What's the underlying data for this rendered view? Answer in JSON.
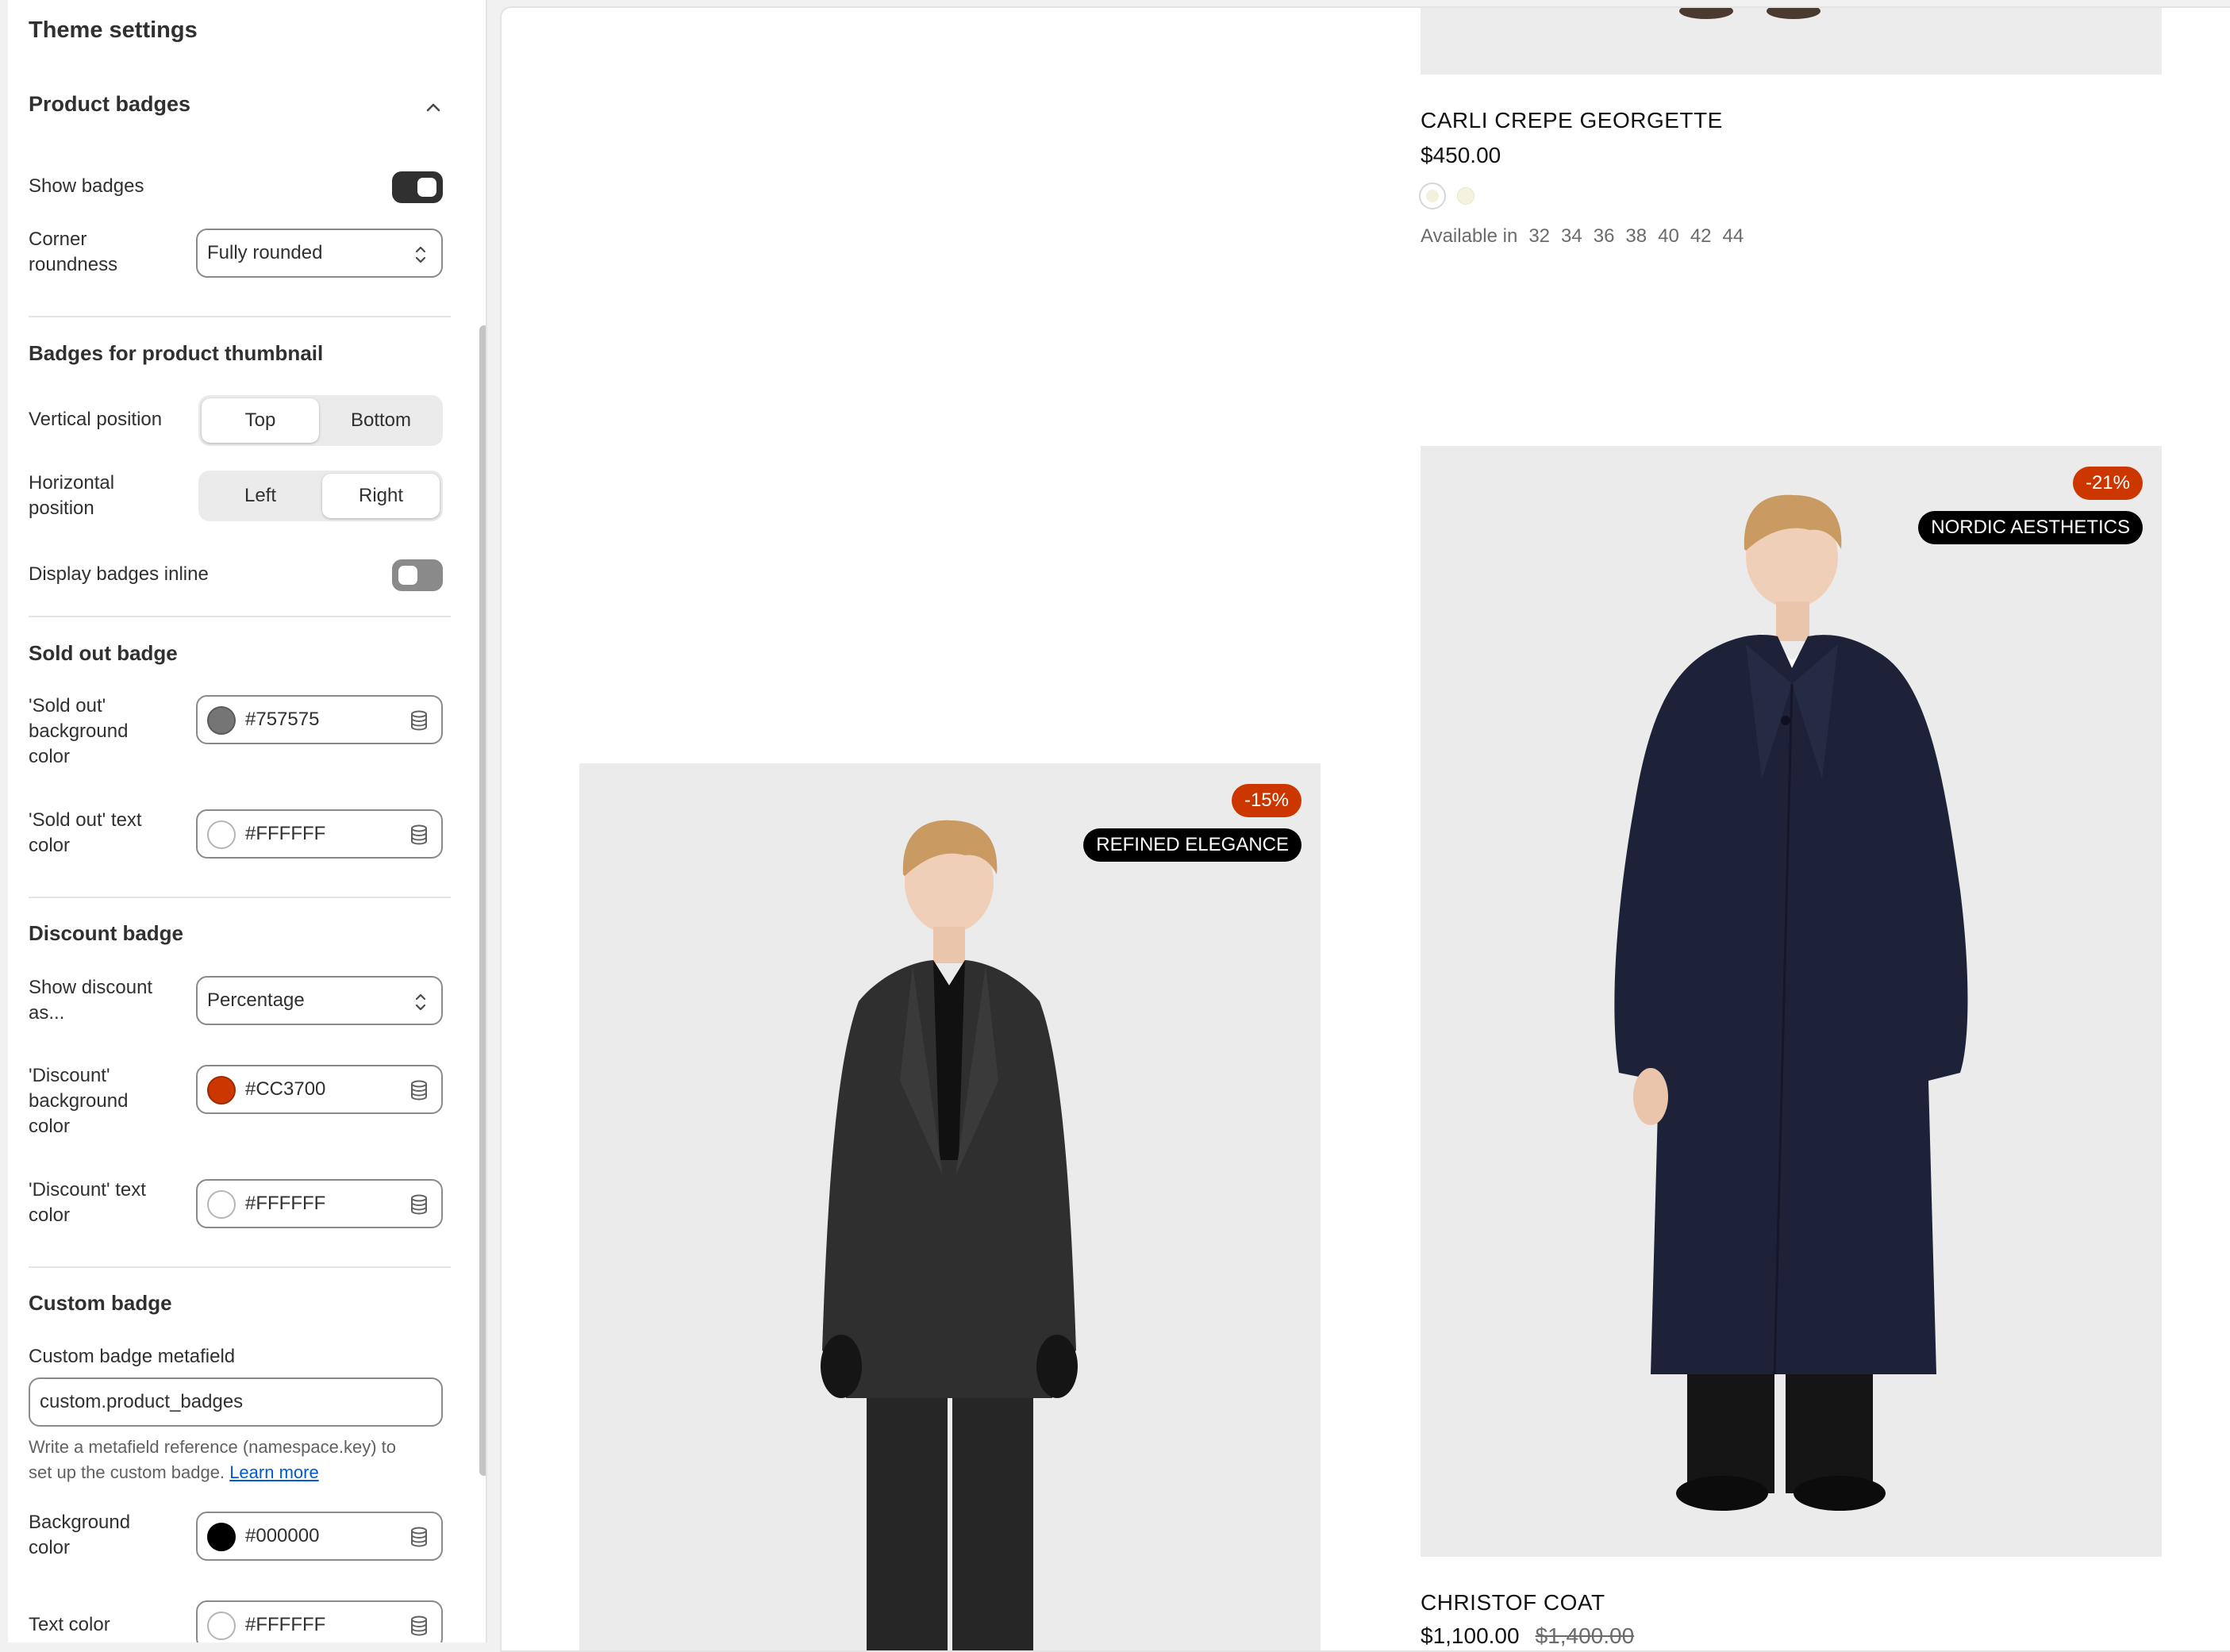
{
  "panel": {
    "title": "Theme settings",
    "product_badges": {
      "heading": "Product badges",
      "show_badges": {
        "label": "Show badges",
        "enabled": true
      },
      "corner_roundness": {
        "label_line1": "Corner",
        "label_line2": "roundness",
        "value": "Fully rounded"
      }
    },
    "thumbnail": {
      "heading": "Badges for product thumbnail",
      "vertical_position": {
        "label": "Vertical position",
        "options": [
          "Top",
          "Bottom"
        ],
        "selected": "Top"
      },
      "horizontal_position": {
        "label_line1": "Horizontal",
        "label_line2": "position",
        "options": [
          "Left",
          "Right"
        ],
        "selected": "Right"
      },
      "display_inline": {
        "label": "Display badges inline",
        "enabled": false
      }
    },
    "sold_out": {
      "heading": "Sold out badge",
      "bg": {
        "label_line1": "'Sold out'",
        "label_line2": "background",
        "label_line3": "color",
        "value": "#757575"
      },
      "text": {
        "label_line1": "'Sold out' text",
        "label_line2": "color",
        "value": "#FFFFFF"
      }
    },
    "discount": {
      "heading": "Discount badge",
      "show_as": {
        "label_line1": "Show discount",
        "label_line2": "as...",
        "value": "Percentage"
      },
      "bg": {
        "label_line1": "'Discount'",
        "label_line2": "background",
        "label_line3": "color",
        "value": "#CC3700"
      },
      "text": {
        "label_line1": "'Discount' text",
        "label_line2": "color",
        "value": "#FFFFFF"
      }
    },
    "custom": {
      "heading": "Custom badge",
      "metafield_label": "Custom badge metafield",
      "metafield_value": "custom.product_badges",
      "help_line1": "Write a metafield reference (namespace.key) to",
      "help_line2": "set up the custom badge.",
      "learn_more": "Learn more",
      "bg": {
        "label_line1": "Background",
        "label_line2": "color",
        "value": "#000000"
      },
      "text": {
        "label": "Text color",
        "value": "#FFFFFF"
      }
    }
  },
  "preview": {
    "products": [
      {
        "title": "CARLI CREPE GEORGETTE",
        "price": "$450.00",
        "available_label": "Available in",
        "sizes": [
          "32",
          "34",
          "36",
          "38",
          "40",
          "42",
          "44"
        ]
      },
      {
        "title": "CHRISTOF COAT",
        "price": "$1,100.00",
        "compare_price": "$1,400.00",
        "discount_badge": "-21%",
        "custom_badge": "NORDIC AESTHETICS"
      },
      {
        "discount_badge": "-15%",
        "custom_badge": "REFINED ELEGANCE"
      }
    ]
  },
  "colors": {
    "sold_out_bg": "#757575",
    "sold_out_text": "#FFFFFF",
    "discount_bg": "#CC3700",
    "discount_text": "#FFFFFF",
    "custom_bg": "#000000",
    "custom_text": "#FFFFFF"
  },
  "icons": [
    "chevron-up-icon",
    "select-arrows-icon",
    "database-icon"
  ]
}
